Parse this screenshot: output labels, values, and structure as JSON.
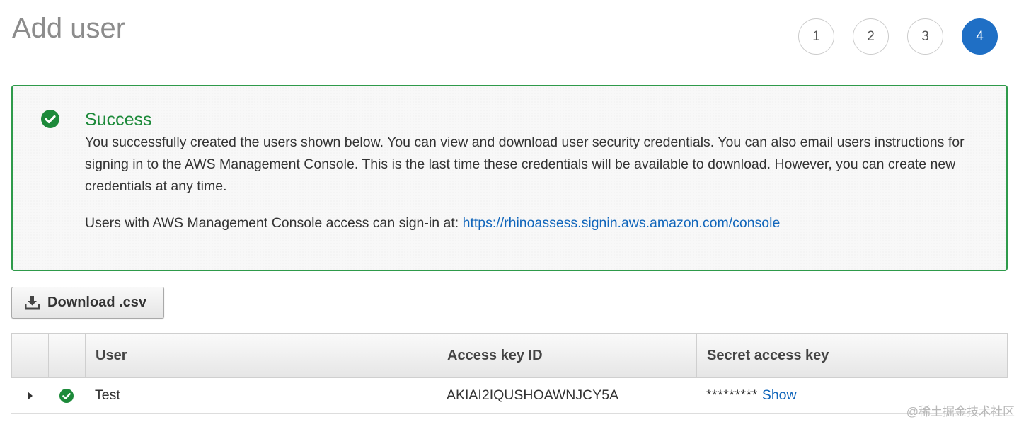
{
  "header": {
    "title": "Add user",
    "steps": [
      "1",
      "2",
      "3",
      "4"
    ],
    "active_step": "4"
  },
  "alert": {
    "icon": "check-circle-icon",
    "title": "Success",
    "message": "You successfully created the users shown below. You can view and download user security credentials. You can also email users instructions for signing in to the AWS Management Console. This is the last time these credentials will be available to download. However, you can create new credentials at any time.",
    "signin_prefix": "Users with AWS Management Console access can sign-in at: ",
    "signin_url": "https://rhinoassess.signin.aws.amazon.com/console"
  },
  "download": {
    "icon": "download-icon",
    "label": "Download .csv"
  },
  "table": {
    "columns": [
      "",
      "",
      "User",
      "Access key ID",
      "Secret access key"
    ],
    "rows": [
      {
        "status_icon": "check-circle-icon",
        "user": "Test",
        "access_key_id": "AKIAI2IQUSHOAWNJCY5A",
        "secret_masked": "*********",
        "secret_action": "Show"
      }
    ]
  },
  "watermark": "@稀土掘金技术社区",
  "colors": {
    "success_green": "#2e9a4a",
    "active_step_blue": "#1f6fc5",
    "link_blue": "#1166bb"
  }
}
